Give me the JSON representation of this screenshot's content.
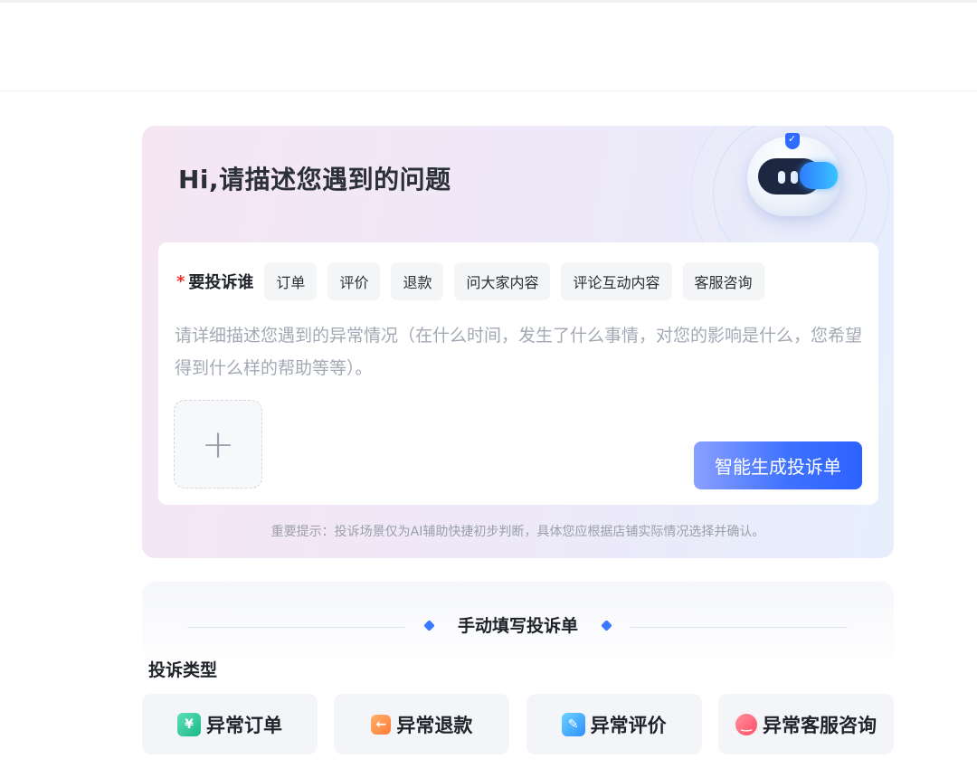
{
  "hero": {
    "title": "Hi,请描述您遇到的问题"
  },
  "complaint": {
    "required_mark": "*",
    "target_label": "要投诉谁",
    "targets": [
      "订单",
      "评价",
      "退款",
      "问大家内容",
      "评论互动内容",
      "客服咨询"
    ],
    "description_placeholder": "请详细描述您遇到的异常情况（在什么时间，发生了什么事情，对您的影响是什么，您希望得到什么样的帮助等等）。",
    "upload_icon": "plus-icon",
    "generate_button": "智能生成投诉单",
    "tip": "重要提示：投诉场景仅为AI辅助快捷初步判断，具体您应根据店铺实际情况选择并确认。"
  },
  "manual": {
    "title": "手动填写投诉单",
    "type_title": "投诉类型",
    "types": [
      {
        "label": "异常订单",
        "icon": "yuan-receipt-icon",
        "glyph": "¥"
      },
      {
        "label": "异常退款",
        "icon": "refund-arrow-icon",
        "glyph": "←"
      },
      {
        "label": "异常评价",
        "icon": "edit-note-icon",
        "glyph": "✎"
      },
      {
        "label": "异常客服咨询",
        "icon": "chat-bubble-icon",
        "glyph": "‿"
      }
    ]
  },
  "colors": {
    "accent": "#2c62ff",
    "required": "#e8322f"
  }
}
